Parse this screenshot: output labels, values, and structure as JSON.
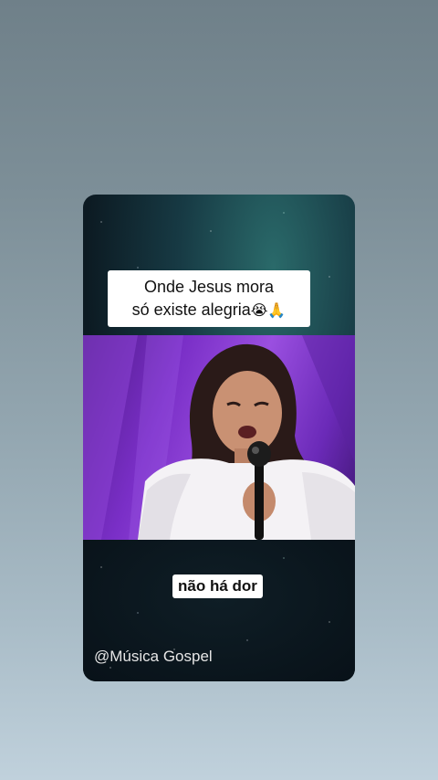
{
  "story": {
    "caption_top": {
      "line1": "Onde Jesus mora",
      "line2": "só existe alegria",
      "emojis": "😭🙏"
    },
    "photo_icon": "woman-singing-with-microphone-image",
    "caption_bottom": "não há dor",
    "watermark": "@Música Gospel"
  },
  "colors": {
    "background_top": "#6f8089",
    "background_bottom": "#c0d1dc",
    "stage_purple": "#7a2fc7",
    "caption_bg": "#ffffff"
  }
}
